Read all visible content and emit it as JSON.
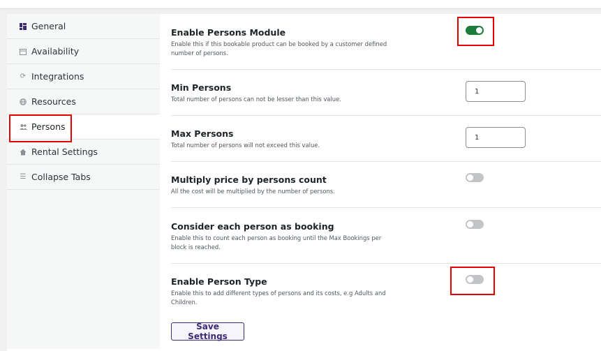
{
  "sidebar": {
    "items": [
      {
        "label": "General",
        "icon": "grid-icon"
      },
      {
        "label": "Availability",
        "icon": "calendar-icon"
      },
      {
        "label": "Integrations",
        "icon": "sync-icon"
      },
      {
        "label": "Resources",
        "icon": "globe-icon"
      },
      {
        "label": "Persons",
        "icon": "persons-icon",
        "active": true
      },
      {
        "label": "Rental Settings",
        "icon": "home-icon"
      },
      {
        "label": "Collapse Tabs",
        "icon": "list-icon"
      }
    ]
  },
  "settings": {
    "enable_persons": {
      "title": "Enable Persons Module",
      "desc": "Enable this if this bookable product can be booked by a customer defined number of persons.",
      "enabled": true
    },
    "min_persons": {
      "title": "Min Persons",
      "desc": "Total number of persons can not be lesser than this value.",
      "value": "1"
    },
    "max_persons": {
      "title": "Max Persons",
      "desc": "Total number of persons will not exceed this value.",
      "value": "1"
    },
    "multiply_price": {
      "title": "Multiply price by persons count",
      "desc": "All the cost will be multiplied by the number of persons.",
      "enabled": false
    },
    "person_as_booking": {
      "title": "Consider each person as booking",
      "desc": "Enable this to count each person as booking until the Max Bookings per block is reached.",
      "enabled": false
    },
    "person_type": {
      "title": "Enable Person Type",
      "desc": "Enable this to add different types of persons and its costs, e.g Adults and Children.",
      "enabled": false
    }
  },
  "save_label": "Save Settings",
  "colors": {
    "accent": "#3c2a78",
    "toggle_on": "#1b7d3a",
    "highlight": "#e60000"
  }
}
